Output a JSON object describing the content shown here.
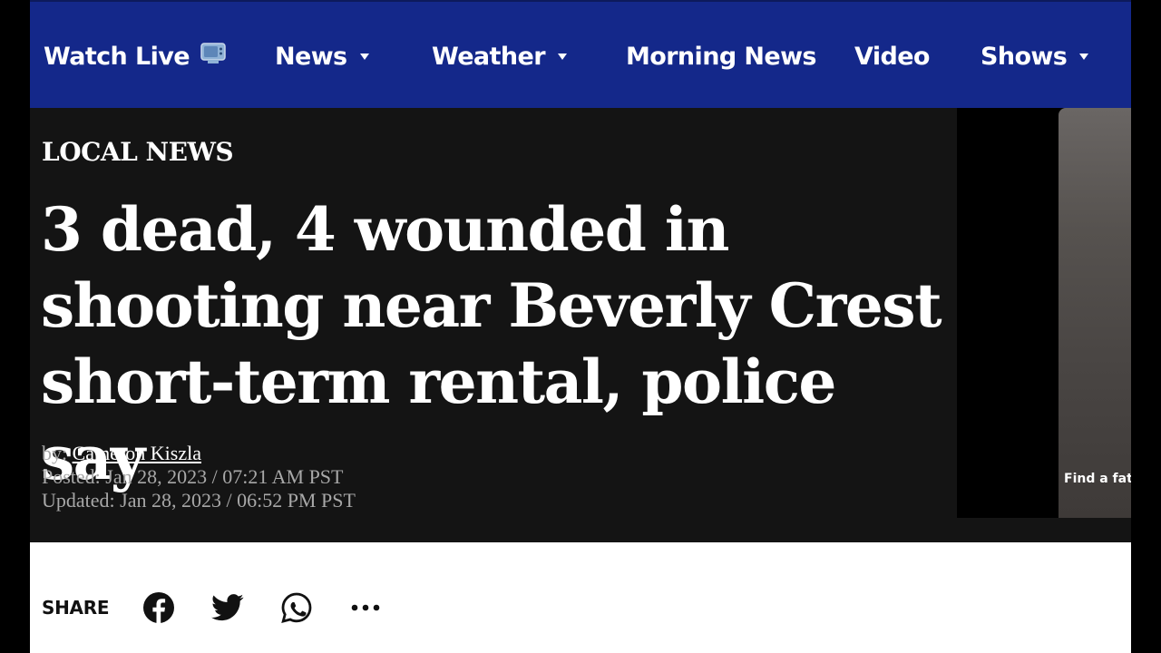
{
  "nav": {
    "watch_live": "Watch Live",
    "news": "News",
    "weather": "Weather",
    "morning_news": "Morning News",
    "video": "Video",
    "shows": "Shows"
  },
  "article": {
    "category": "LOCAL NEWS",
    "headline": "3 dead, 4 wounded in shooting near Beverly Crest short-term rental, police say",
    "by_prefix": "by: ",
    "author": "Cameron Kiszla",
    "posted": "Posted: Jan 28, 2023 / 07:21 AM PST",
    "updated": "Updated: Jan 28, 2023 / 06:52 PM PST"
  },
  "video": {
    "caption": "Find a fath"
  },
  "share": {
    "label": "SHARE",
    "icons": [
      "facebook-icon",
      "twitter-icon",
      "whatsapp-icon",
      "more-icon"
    ]
  },
  "colors": {
    "nav_bg": "#14288a",
    "hero_bg": "#141414",
    "meta_text": "#a8a8a8"
  }
}
